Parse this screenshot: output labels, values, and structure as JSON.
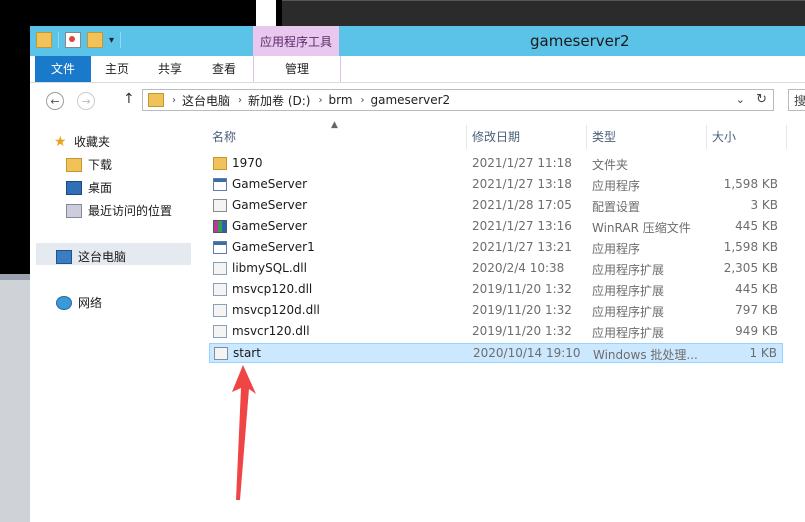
{
  "window": {
    "title": "gameserver2",
    "contextual_group": "应用程序工具"
  },
  "qat": {
    "dropdown": "▾"
  },
  "ribbon": {
    "tabs": [
      {
        "label": "文件"
      },
      {
        "label": "主页"
      },
      {
        "label": "共享"
      },
      {
        "label": "查看"
      },
      {
        "label": "管理"
      }
    ]
  },
  "address": {
    "crumbs": [
      "这台电脑",
      "新加卷 (D:)",
      "brm",
      "gameserver2"
    ],
    "search_placeholder": "搜"
  },
  "nav": {
    "favorites": "收藏夹",
    "downloads": "下载",
    "desktop": "桌面",
    "recent": "最近访问的位置",
    "this_pc": "这台电脑",
    "network": "网络"
  },
  "columns": {
    "name": "名称",
    "date": "修改日期",
    "type": "类型",
    "size": "大小"
  },
  "files": [
    {
      "name": "1970",
      "date": "2021/1/27 11:18",
      "type": "文件夹",
      "size": "",
      "icon": "folder-icon"
    },
    {
      "name": "GameServer",
      "date": "2021/1/27 13:18",
      "type": "应用程序",
      "size": "1,598 KB",
      "icon": "exe-icon"
    },
    {
      "name": "GameServer",
      "date": "2021/1/28 17:05",
      "type": "配置设置",
      "size": "3 KB",
      "icon": "config-icon"
    },
    {
      "name": "GameServer",
      "date": "2021/1/27 13:16",
      "type": "WinRAR 压缩文件",
      "size": "445 KB",
      "icon": "winrar-icon"
    },
    {
      "name": "GameServer1",
      "date": "2021/1/27 13:21",
      "type": "应用程序",
      "size": "1,598 KB",
      "icon": "exe-icon"
    },
    {
      "name": "libmySQL.dll",
      "date": "2020/2/4 10:38",
      "type": "应用程序扩展",
      "size": "2,305 KB",
      "icon": "dll-icon"
    },
    {
      "name": "msvcp120.dll",
      "date": "2019/11/20 1:32",
      "type": "应用程序扩展",
      "size": "445 KB",
      "icon": "dll-icon"
    },
    {
      "name": "msvcp120d.dll",
      "date": "2019/11/20 1:32",
      "type": "应用程序扩展",
      "size": "797 KB",
      "icon": "dll-icon"
    },
    {
      "name": "msvcr120.dll",
      "date": "2019/11/20 1:32",
      "type": "应用程序扩展",
      "size": "949 KB",
      "icon": "dll-icon"
    },
    {
      "name": "start",
      "date": "2020/10/14 19:10",
      "type": "Windows 批处理...",
      "size": "1 KB",
      "icon": "batch-icon",
      "selected": true
    }
  ],
  "annotation": {
    "arrow_color": "#f04545"
  }
}
